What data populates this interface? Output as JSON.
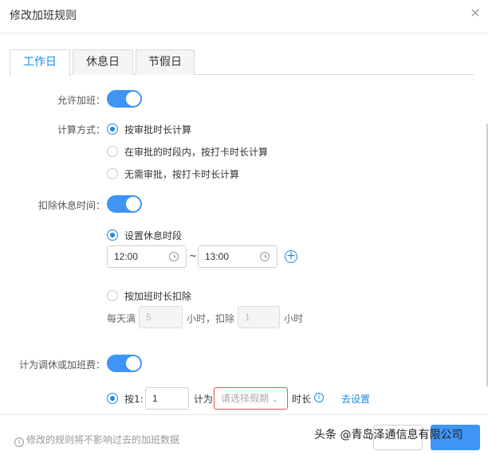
{
  "dialog": {
    "title": "修改加班规则",
    "close_glyph": "×"
  },
  "tabs": [
    {
      "label": "工作日",
      "active": true
    },
    {
      "label": "休息日",
      "active": false
    },
    {
      "label": "节假日",
      "active": false
    }
  ],
  "allow_overtime": {
    "label": "允许加班：",
    "enabled": true
  },
  "calc_method": {
    "label": "计算方式：",
    "options": [
      {
        "label": "按审批时长计算",
        "checked": true
      },
      {
        "label": "在审批的时段内，按打卡时长计算",
        "checked": false
      },
      {
        "label": "无需审批，按打卡时长计算",
        "checked": false
      }
    ]
  },
  "deduct_rest": {
    "label": "扣除休息时间：",
    "enabled": true,
    "set_period": {
      "label": "设置休息时段",
      "checked": true,
      "start": "12:00",
      "separator": "~",
      "end": "13:00"
    },
    "by_duration": {
      "label": "按加班时长扣除",
      "checked": false,
      "prefix": "每天满",
      "full_hours": "5",
      "mid": "小时，扣除",
      "deduct_hours": "1",
      "suffix": "小时"
    }
  },
  "comp_leave": {
    "label": "计为调休或加班费：",
    "enabled": true,
    "rule": {
      "checked": true,
      "prefix": "按1:",
      "ratio": "1",
      "count_as": "计为",
      "leave_placeholder": "请选择假期",
      "duration": "时长",
      "settings_link": "去设置"
    }
  },
  "footer": {
    "note": "修改的规则将不影响过去的加班数据",
    "cancel_label": "",
    "ok_label": ""
  },
  "watermark": "头条 @青岛泽通信息有限公司",
  "colors": {
    "accent": "#1a8be0",
    "switch_on": "#3e95f5",
    "error_border": "#e05252"
  }
}
